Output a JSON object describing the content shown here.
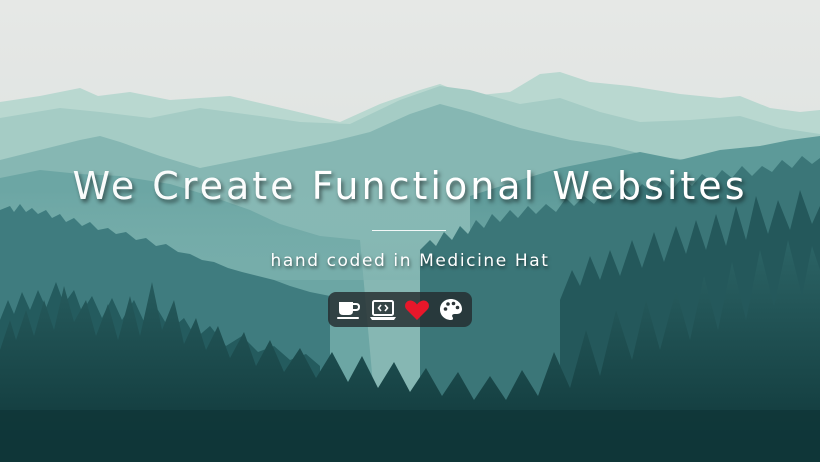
{
  "hero": {
    "title_light": "We Create",
    "title_bold": "Functional Websites",
    "subtitle": "hand coded in Medicine Hat"
  },
  "icons": [
    {
      "name": "coffee-cup-icon",
      "color": "#ffffff"
    },
    {
      "name": "laptop-code-icon",
      "color": "#ffffff"
    },
    {
      "name": "heart-icon",
      "color": "#e8172a"
    },
    {
      "name": "palette-icon",
      "color": "#ffffff"
    }
  ],
  "colors": {
    "sky": "#e4e7e5",
    "mountain_far": "#a9cfc6",
    "mountain_mid": "#6fa9a6",
    "forest_dark": "#123f42",
    "accent_heart": "#e8172a"
  }
}
